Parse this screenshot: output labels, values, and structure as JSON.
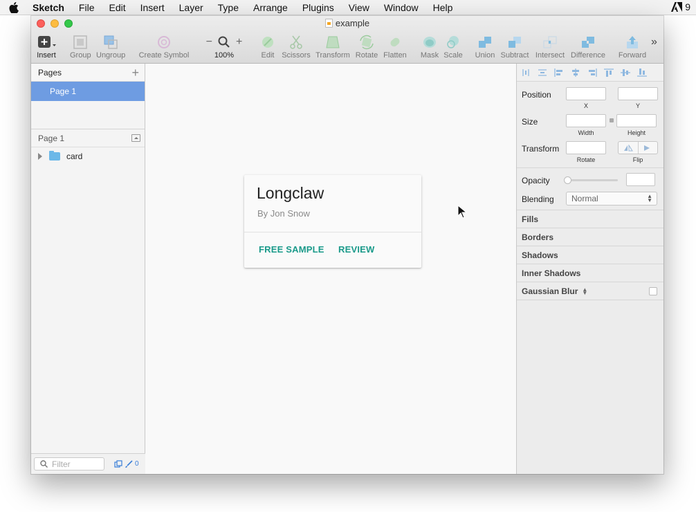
{
  "menubar": {
    "app_name": "Sketch",
    "items": [
      "File",
      "Edit",
      "Insert",
      "Layer",
      "Type",
      "Arrange",
      "Plugins",
      "View",
      "Window",
      "Help"
    ],
    "right_status": "9"
  },
  "window": {
    "title": "example"
  },
  "toolbar": {
    "insert": "Insert",
    "group": "Group",
    "ungroup": "Ungroup",
    "create_symbol": "Create Symbol",
    "zoom": "100%",
    "edit": "Edit",
    "scissors": "Scissors",
    "transform": "Transform",
    "rotate": "Rotate",
    "flatten": "Flatten",
    "mask": "Mask",
    "scale": "Scale",
    "union": "Union",
    "subtract": "Subtract",
    "intersect": "Intersect",
    "difference": "Difference",
    "forward": "Forward"
  },
  "pages": {
    "header": "Pages",
    "items": [
      {
        "label": "Page 1",
        "selected": true
      }
    ]
  },
  "layers": {
    "header": "Page 1",
    "items": [
      {
        "label": "card",
        "icon": "folder-icon"
      }
    ],
    "filter_placeholder": "Filter",
    "count": "0"
  },
  "card": {
    "title": "Longclaw",
    "subtitle": "By Jon Snow",
    "actions": [
      "FREE SAMPLE",
      "REVIEW"
    ],
    "accent_color": "#1a9a8a"
  },
  "inspector": {
    "position": {
      "label": "Position",
      "x_label": "X",
      "y_label": "Y"
    },
    "size": {
      "label": "Size",
      "width_label": "Width",
      "height_label": "Height"
    },
    "transform": {
      "label": "Transform",
      "rotate_label": "Rotate",
      "flip_label": "Flip"
    },
    "opacity": {
      "label": "Opacity",
      "value": 0
    },
    "blending": {
      "label": "Blending",
      "value": "Normal"
    },
    "sections": [
      "Fills",
      "Borders",
      "Shadows",
      "Inner Shadows"
    ],
    "gaussian_blur": "Gaussian Blur"
  },
  "colors": {
    "selection": "#6e9ce2",
    "accent": "#1a9a8a",
    "shape_icon": "#7fc2c0"
  }
}
